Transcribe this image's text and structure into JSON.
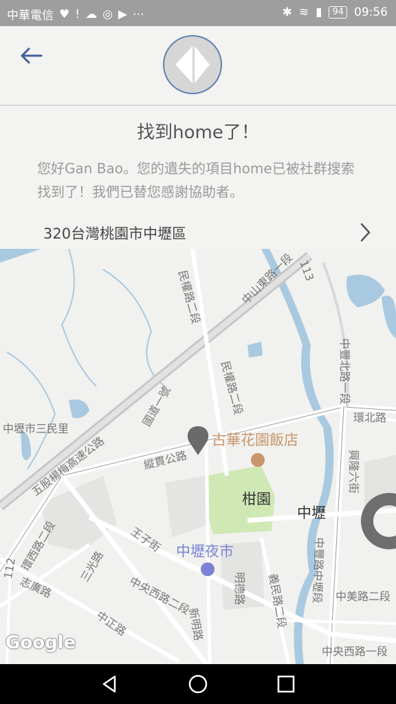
{
  "status": {
    "carrier": "中華電信",
    "battery": "94",
    "time": "09:56"
  },
  "header": {
    "back_icon": "arrow-left-icon",
    "logo_icon": "diamond-logo-icon"
  },
  "content": {
    "title": "找到home了！",
    "message": "您好Gan Bao。您的遺失的項目home已被社群搜索找到了！我們已替您感謝協助者。",
    "address": "320台灣桃園市中壢區"
  },
  "map": {
    "labels": {
      "l1": "民權路二段",
      "l2": "中山東路一段",
      "l3": "113",
      "l4": "民權路二段",
      "l5": "中豐北路一段",
      "l6": "環北路",
      "l7": "中壢市三民里",
      "l8": "五股楊梅高速公路",
      "l9": "國道一號",
      "l10": "縱貫公路",
      "l11": "古華花園飯店",
      "l12": "柑園",
      "l13": "中壢",
      "l14": "興隆六街",
      "l15": "王子街",
      "l16": "中壢夜市",
      "l17": "環西路二段",
      "l18": "志廣路",
      "l19": "三光路",
      "l20": "中央西路二段",
      "l21": "明德路",
      "l22": "義民路二段",
      "l23": "中豐路中壢段",
      "l24": "中美路二段",
      "l25": "中正路",
      "l26": "新明路",
      "l27": "112",
      "l28": "中央西路一段",
      "google": "Google"
    },
    "colors": {
      "water": "#a9c9e0",
      "park": "#cfe8b4",
      "road": "#ffffff",
      "highway": "#dcdcdc",
      "pin": "#6a6a6a",
      "poi": "#c9956b",
      "market": "#7b84d4"
    }
  },
  "nav": {
    "back": "nav-back-icon",
    "home": "nav-home-icon",
    "recents": "nav-recents-icon"
  }
}
